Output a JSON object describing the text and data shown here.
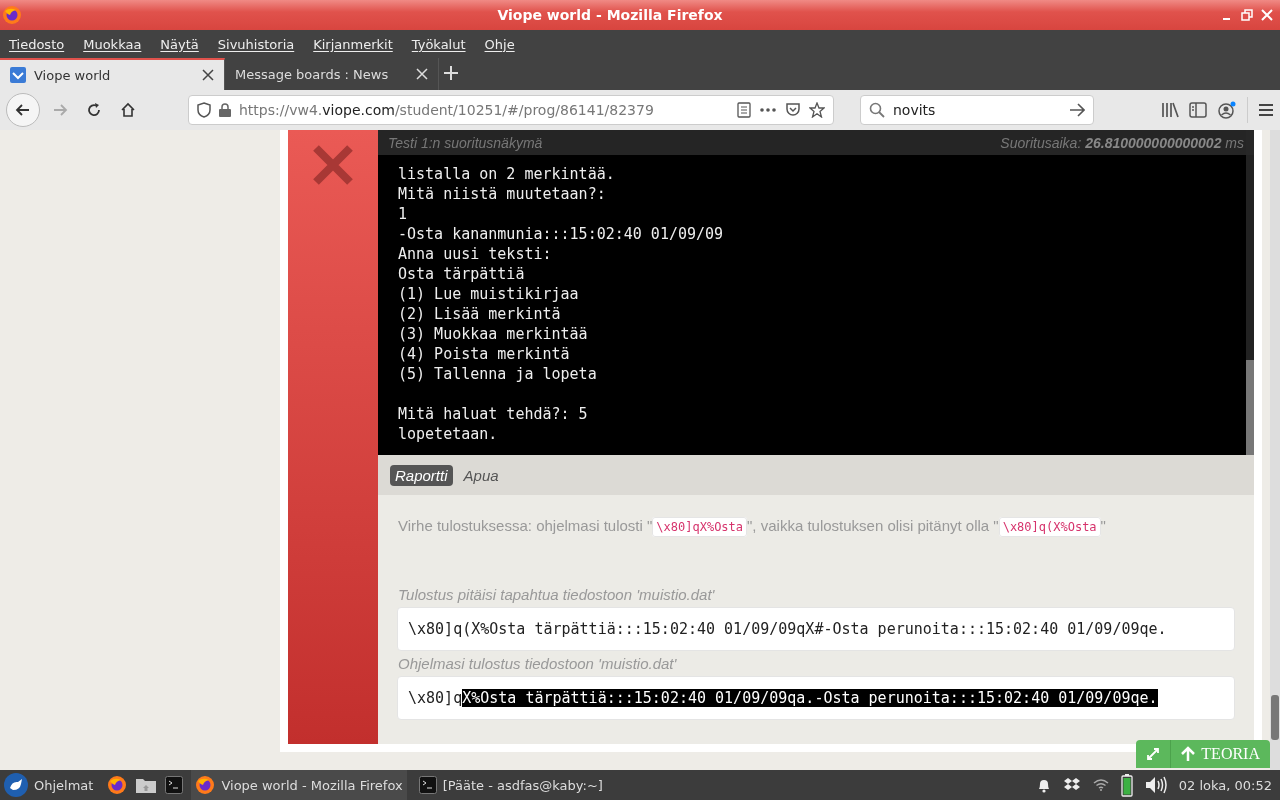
{
  "window": {
    "title": "Viope world - Mozilla Firefox"
  },
  "menu": [
    "Tiedosto",
    "Muokkaa",
    "Näytä",
    "Sivuhistoria",
    "Kirjanmerkit",
    "Työkalut",
    "Ohje"
  ],
  "tabs": [
    {
      "label": "Viope world",
      "selected": true
    },
    {
      "label": "Message boards : News",
      "selected": false
    }
  ],
  "address": {
    "prefix": "https://vw4.",
    "domain": "viope.com",
    "path": "/student/10251/#/prog/86141/82379"
  },
  "search": {
    "value": "novits"
  },
  "test": {
    "passed": false,
    "header_title": "Testi 1:n suoritusnäkymä",
    "time": "Suoritusaika: **26.810000000000002** ms",
    "console_blocks": [
      [
        "listalla on 2 merkintää.",
        "Mitä niistä muutetaan?:",
        "1",
        "-Osta kananmunia:::15:02:40 01/09/09",
        "Anna uusi teksti:",
        "Osta tärpättiä",
        "(1) Lue muistikirjaa",
        "(2) Lisää merkintä",
        "(3) Muokkaa merkintää",
        "(4) Poista merkintä",
        "(5) Tallenna ja lopeta"
      ],
      [
        "Mitä haluat tehdä?: 5",
        "lopetetaan."
      ]
    ]
  },
  "report_tabs": [
    {
      "label": "Raportti",
      "selected": true
    },
    {
      "label": "Apua",
      "selected": false
    }
  ],
  "error_message": [
    {
      "kind": "text",
      "text": "Virhe tulostuksessa: ohjelmasi tulosti \""
    },
    {
      "kind": "code",
      "text": "\\x80]qX%Osta"
    },
    {
      "kind": "text",
      "text": "\", vaikka tulostuksen olisi pitänyt olla \""
    },
    {
      "kind": "code",
      "text": "\\x80]q(X%Osta"
    },
    {
      "kind": "text",
      "text": "\""
    }
  ],
  "expected": {
    "label": "Tulostus pitäisi tapahtua tiedostoon 'muistio.dat'",
    "value": "\\x80]q(X%Osta tärpättiä:::15:02:40 01/09/09qX#-Osta perunoita:::15:02:40 01/09/09qe."
  },
  "actual": {
    "label": "Ohjelmasi tulostus tiedostoon 'muistio.dat'",
    "value": "\\x80]q",
    "selected_text": "X%Osta tärpättiä:::15:02:40 01/09/09qa.-Osta perunoita:::15:02:40 01/09/09qe."
  },
  "theory_button": {
    "label": "TEORIA"
  },
  "taskbar": {
    "start": "Ohjelmat",
    "tasks": [
      {
        "label": "Viope world - Mozilla Firefox",
        "selected": true,
        "kind": "browser"
      },
      {
        "label": "[Pääte - asdfas@kaby:~]",
        "selected": false,
        "kind": "terminal"
      }
    ],
    "clock": "02 loka, 00:52"
  }
}
